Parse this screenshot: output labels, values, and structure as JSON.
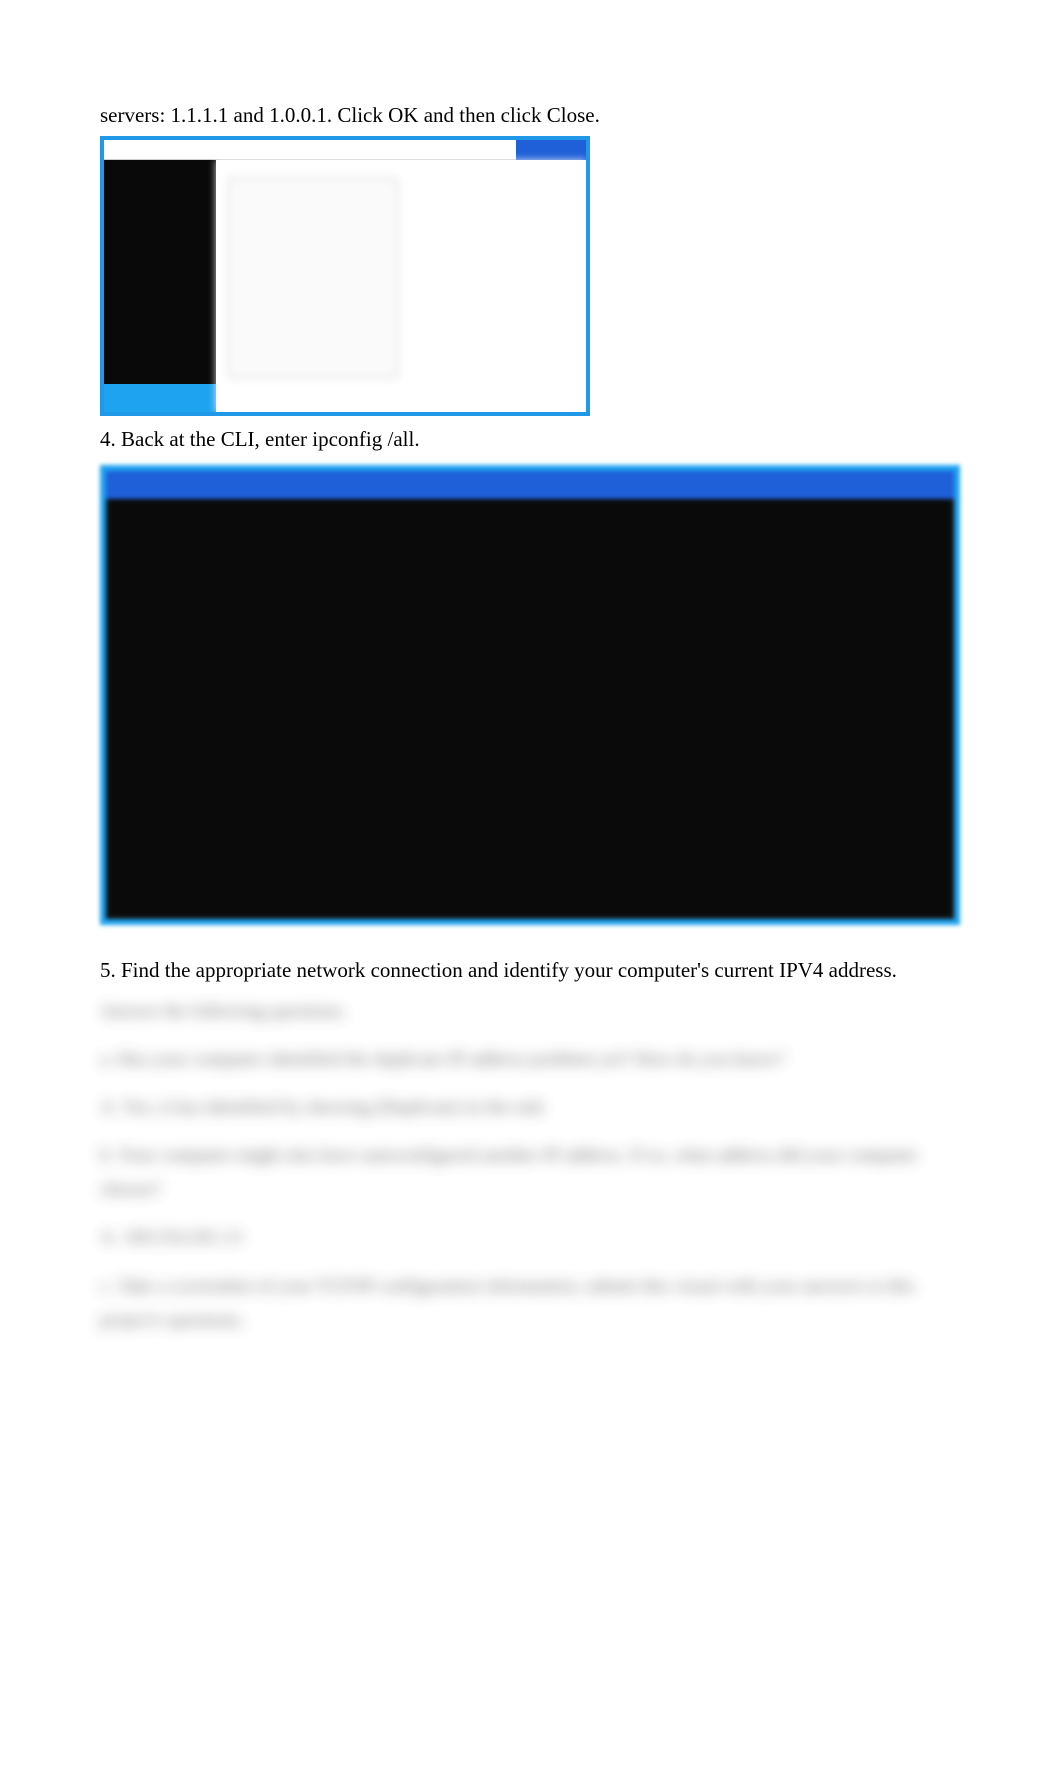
{
  "intro": "servers: 1.1.1.1 and 1.0.0.1. Click OK and then click Close.",
  "step4": "4. Back at the CLI, enter ipconfig /all.",
  "step5": "5. Find the appropriate network connection and identify your computer's current IPV4 address.",
  "blurred": {
    "heading": "Answer the following questions.",
    "q1": "a. Has your computer identified the duplicate IP address problem yet? How do you know?",
    "a1": "A. Yes, it has identified by showing (Duplicate) in the end.",
    "q2": "b. Your computer might also have autoconfigured another IP address. If so, what address did your computer choose?",
    "a2": "A. 169.254.201.13",
    "q3": "c. Take a screenshot of your TCP/IP configuration information; submit this visual with your answers to this project's questions."
  }
}
